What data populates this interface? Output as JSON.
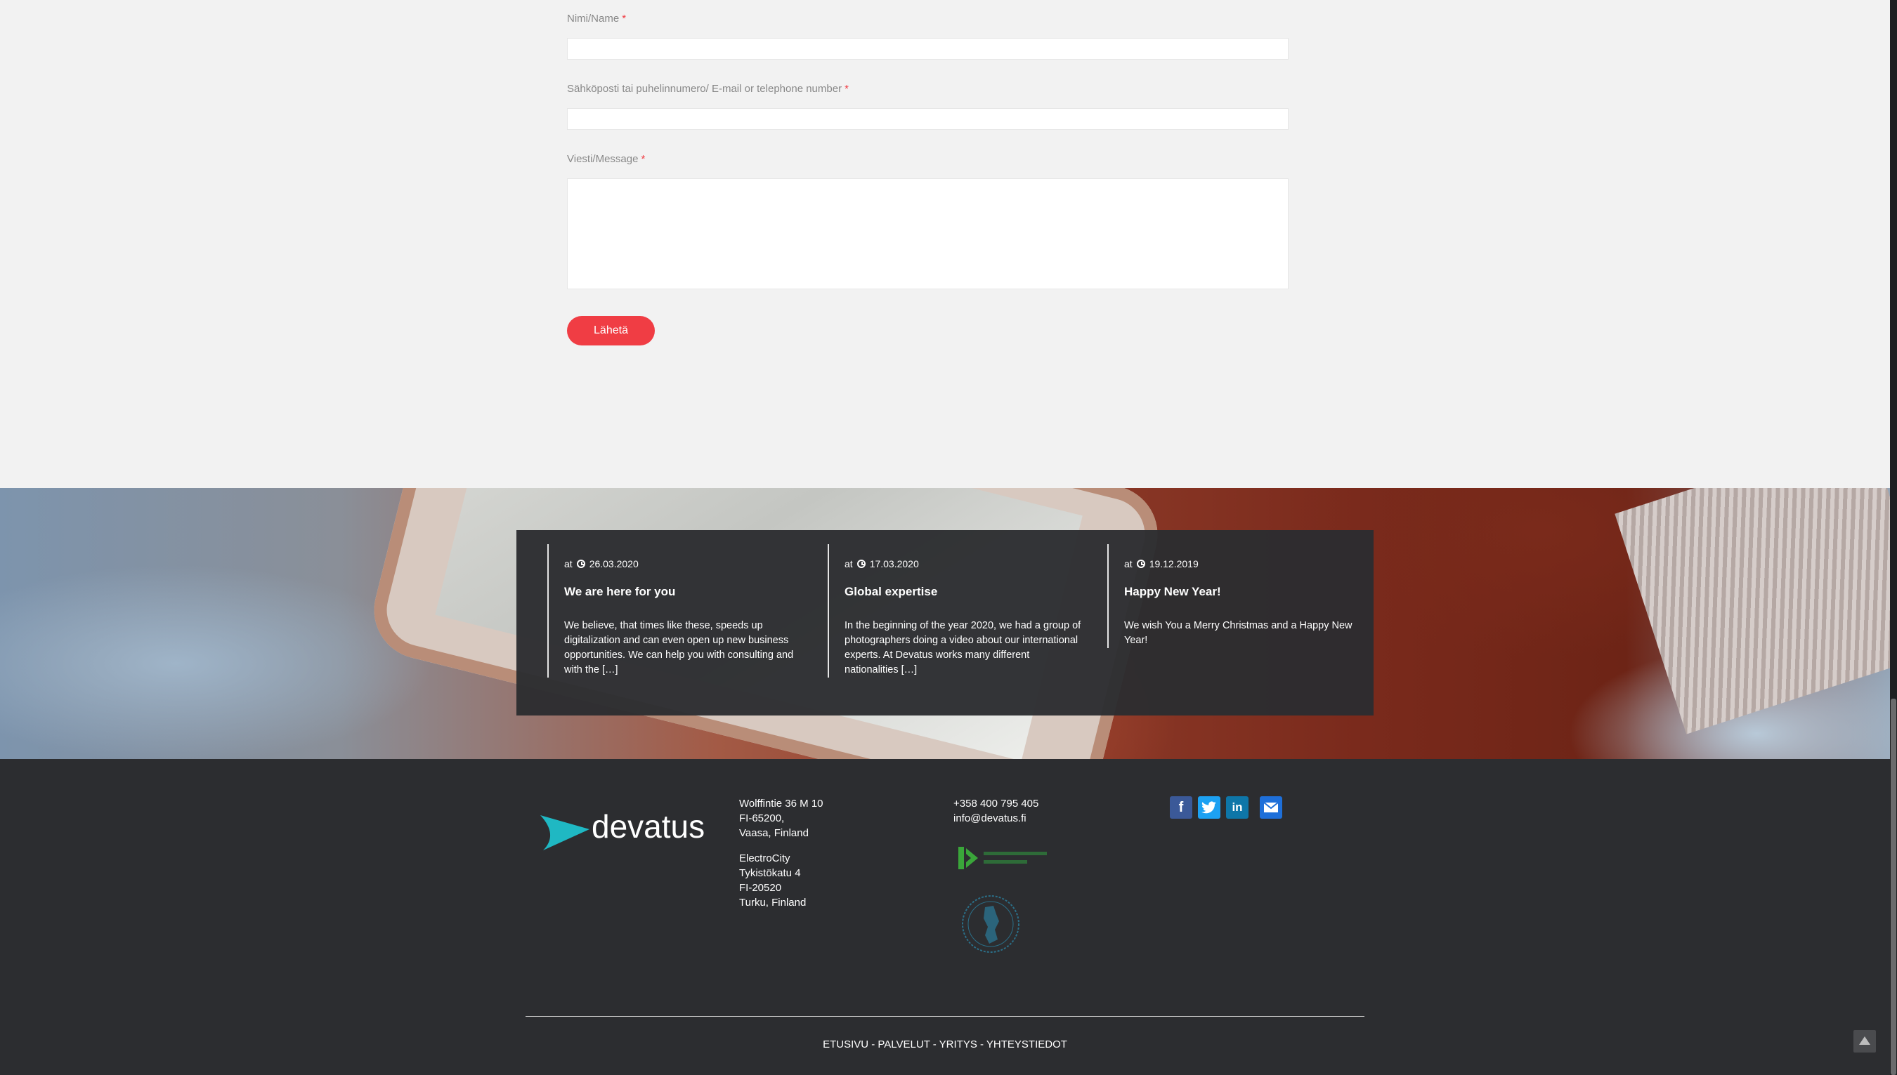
{
  "form": {
    "name_label": "Nimi/Name",
    "email_label": "Sähköposti tai puhelinnumero/ E-mail or telephone number",
    "message_label": "Viesti/Message",
    "required_mark": "*",
    "name_value": "",
    "email_value": "",
    "message_value": "",
    "submit_label": "Lähetä"
  },
  "news": [
    {
      "prefix": "at",
      "date": "26.03.2020",
      "title": "We are here for you",
      "excerpt": "We believe, that times like these, speeds up digitalization and can even open up new business opportunities. We can help you with consulting and with the […]"
    },
    {
      "prefix": "at",
      "date": "17.03.2020",
      "title": "Global expertise",
      "excerpt": "In the beginning of the year 2020, we had a group of photographers doing a video about our international experts. At Devatus works many different nationalities […]"
    },
    {
      "prefix": "at",
      "date": "19.12.2019",
      "title": "Happy New Year!",
      "excerpt": "We wish You a Merry Christmas and a Happy New Year!"
    }
  ],
  "footer": {
    "logo_text": "devatus",
    "address1": [
      "Wolffintie 36 M 10",
      "FI-65200,",
      "Vaasa, Finland"
    ],
    "address2": [
      "ElectroCity",
      "Tykistökatu 4",
      "FI-20520",
      "Turku, Finland"
    ],
    "phone": "+358 400 795 405",
    "email": "info@devatus.fi",
    "social": [
      "facebook-icon",
      "twitter-icon",
      "linkedin-icon",
      "mail-icon"
    ],
    "nav": "ETUSIVU - PALVELUT - YRITYS - YHTEYSTIEDOT"
  },
  "colors": {
    "accent": "#f03d44",
    "logo_teal": "#1fb8c3",
    "footer_bg": "#2c2d30",
    "facebook": "#3b5998",
    "twitter": "#1da1f2",
    "linkedin": "#0e76a8",
    "mail": "#1e6fd9"
  }
}
